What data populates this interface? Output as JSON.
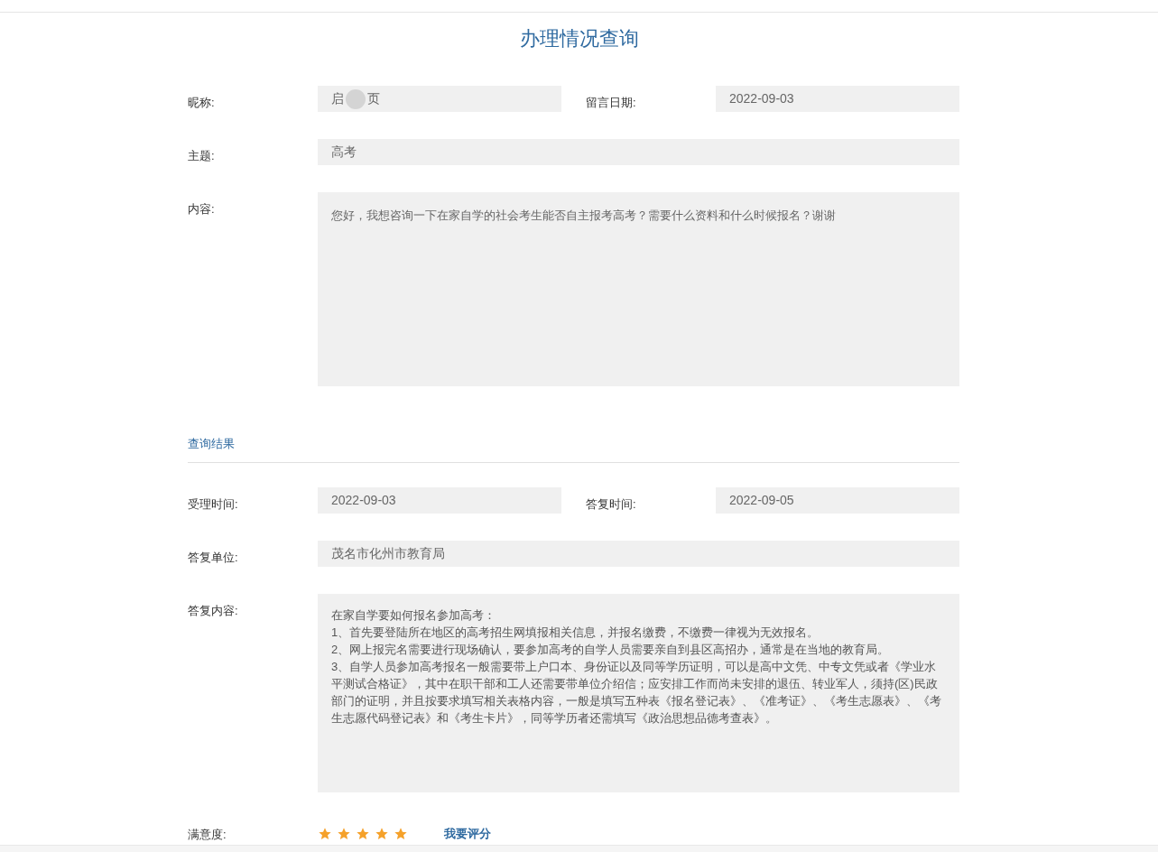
{
  "title": "办理情况查询",
  "message": {
    "nickname_label": "昵称:",
    "nickname_parts": [
      "启",
      "页"
    ],
    "date_label": "留言日期:",
    "date": "2022-09-03",
    "subject_label": "主题:",
    "subject": "高考",
    "content_label": "内容:",
    "content": "您好，我想咨询一下在家自学的社会考生能否自主报考高考？需要什么资料和什么时候报名？谢谢"
  },
  "result": {
    "heading": "查询结果",
    "accepted_label": "受理时间:",
    "accepted": "2022-09-03",
    "replied_label": "答复时间:",
    "replied": "2022-09-05",
    "unit_label": "答复单位:",
    "unit": "茂名市化州市教育局",
    "reply_label": "答复内容:",
    "reply_lines": [
      "在家自学要如何报名参加高考：",
      "1、首先要登陆所在地区的高考招生网填报相关信息，并报名缴费，不缴费一律视为无效报名。",
      "2、网上报完名需要进行现场确认，要参加高考的自学人员需要亲自到县区高招办，通常是在当地的教育局。",
      "3、自学人员参加高考报名一般需要带上户口本、身份证以及同等学历证明，可以是高中文凭、中专文凭或者《学业水平测试合格证》，其中在职干部和工人还需要带单位介绍信；应安排工作而尚未安排的退伍、转业军人，须持(区)民政部门的证明，并且按要求填写相关表格内容，一般是填写五种表《报名登记表》、《准考证》、《考生志愿表》、《考生志愿代码登记表》和《考生卡片》，同等学历者还需填写《政治思想品德考查表》。"
    ]
  },
  "rating": {
    "label": "满意度:",
    "stars": 5,
    "link": "我要评分"
  }
}
